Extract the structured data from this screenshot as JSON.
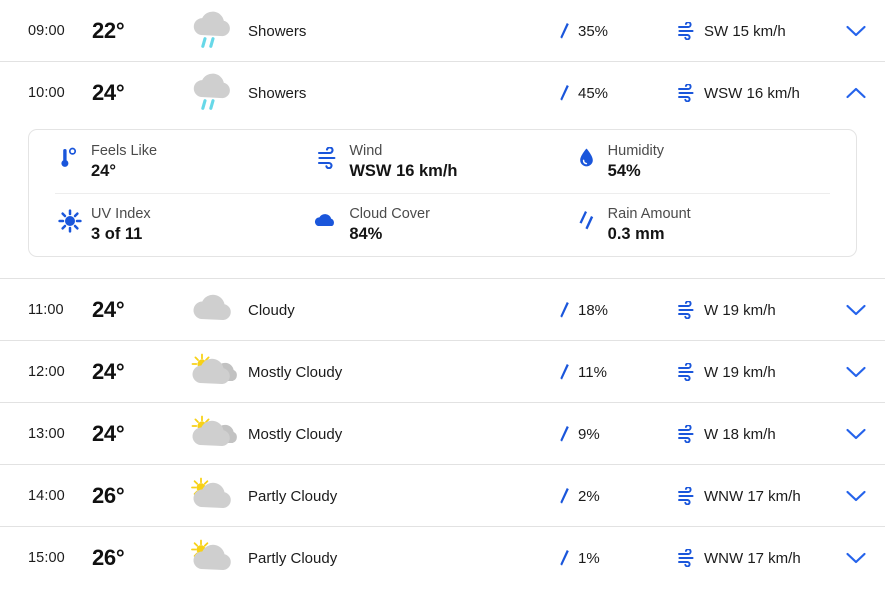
{
  "theme": {
    "accent_blue": "#1a56db",
    "link_blue": "#2563eb",
    "cloud_gray": "#cfcfcf",
    "sun_yellow": "#f7d117",
    "rain_cyan": "#67d8e8",
    "divider": "#e2e2e2",
    "text": "#1b1b1b"
  },
  "forecast": {
    "hours": [
      {
        "time": "09:00",
        "temp": "22°",
        "condition": "Showers",
        "icon": "showers-icon",
        "precip": "35%",
        "precip_icon": "raindrop-icon",
        "wind": "SW 15 km/h",
        "wind_icon": "wind-icon",
        "toggle_icon": "chevron-down-icon",
        "expanded": false
      },
      {
        "time": "10:00",
        "temp": "24°",
        "condition": "Showers",
        "icon": "showers-icon",
        "precip": "45%",
        "precip_icon": "raindrop-icon",
        "wind": "WSW 16 km/h",
        "wind_icon": "wind-icon",
        "toggle_icon": "chevron-up-icon",
        "expanded": true
      },
      {
        "time": "11:00",
        "temp": "24°",
        "condition": "Cloudy",
        "icon": "cloudy-icon",
        "precip": "18%",
        "precip_icon": "raindrop-icon",
        "wind": "W 19 km/h",
        "wind_icon": "wind-icon",
        "toggle_icon": "chevron-down-icon",
        "expanded": false
      },
      {
        "time": "12:00",
        "temp": "24°",
        "condition": "Mostly Cloudy",
        "icon": "mostly-cloudy-icon",
        "precip": "11%",
        "precip_icon": "raindrop-icon",
        "wind": "W 19 km/h",
        "wind_icon": "wind-icon",
        "toggle_icon": "chevron-down-icon",
        "expanded": false
      },
      {
        "time": "13:00",
        "temp": "24°",
        "condition": "Mostly Cloudy",
        "icon": "mostly-cloudy-icon",
        "precip": "9%",
        "precip_icon": "raindrop-icon",
        "wind": "W 18 km/h",
        "wind_icon": "wind-icon",
        "toggle_icon": "chevron-down-icon",
        "expanded": false
      },
      {
        "time": "14:00",
        "temp": "26°",
        "condition": "Partly Cloudy",
        "icon": "partly-cloudy-icon",
        "precip": "2%",
        "precip_icon": "raindrop-icon",
        "wind": "WNW 17 km/h",
        "wind_icon": "wind-icon",
        "toggle_icon": "chevron-down-icon",
        "expanded": false
      },
      {
        "time": "15:00",
        "temp": "26°",
        "condition": "Partly Cloudy",
        "icon": "partly-cloudy-icon",
        "precip": "1%",
        "precip_icon": "raindrop-icon",
        "wind": "WNW 17 km/h",
        "wind_icon": "wind-icon",
        "toggle_icon": "chevron-down-icon",
        "expanded": false
      }
    ],
    "expanded_detail": {
      "for_time": "10:00",
      "metrics": [
        {
          "label": "Feels Like",
          "value": "24°",
          "icon": "thermometer-icon"
        },
        {
          "label": "Wind",
          "value": "WSW 16 km/h",
          "icon": "wind-icon"
        },
        {
          "label": "Humidity",
          "value": "54%",
          "icon": "water-drop-icon"
        },
        {
          "label": "UV Index",
          "value": "3 of 11",
          "icon": "uv-sun-icon"
        },
        {
          "label": "Cloud Cover",
          "value": "84%",
          "icon": "cloud-filled-icon"
        },
        {
          "label": "Rain Amount",
          "value": "0.3 mm",
          "icon": "rain-amount-icon"
        }
      ]
    }
  }
}
